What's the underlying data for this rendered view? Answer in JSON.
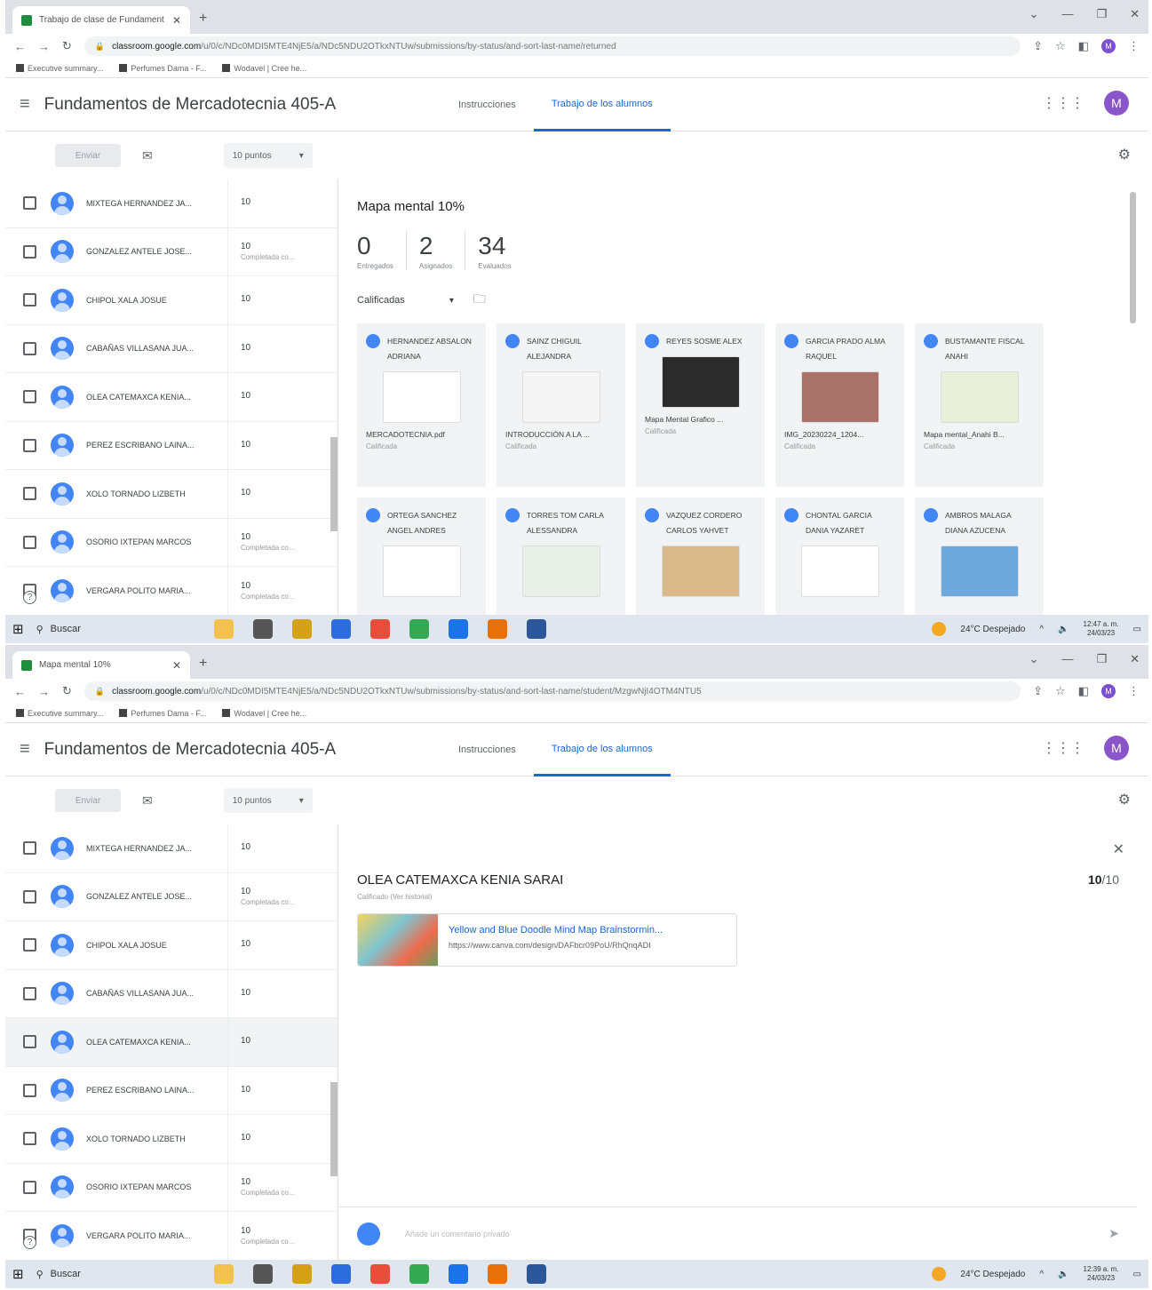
{
  "shots": [
    {
      "tab_title": "Trabajo de clase de Fundament",
      "url_domain": "classroom.google.com",
      "url_rest": "/u/0/c/NDc0MDI5MTE4NjE5/a/NDc5NDU2OTkxNTUw/submissions/by-status/and-sort-last-name/returned",
      "panel": "overview"
    },
    {
      "tab_title": "Mapa mental 10%",
      "url_domain": "classroom.google.com",
      "url_rest": "/u/0/c/NDc0MDI5MTE4NjE5/a/NDc5NDU2OTkxNTUw/submissions/by-status/and-sort-last-name/student/MzgwNjI4OTM4NTU5",
      "panel": "detail"
    }
  ],
  "browser": {
    "bookmarks": [
      "Executive summary...",
      "Perfumes Dama - F...",
      "Wodavel | Cree he..."
    ]
  },
  "classroom": {
    "course_title": "Fundamentos de Mercadotecnia 405-A",
    "nav_instructions": "Instrucciones",
    "nav_student_work": "Trabajo de los alumnos",
    "avatar_letter": "M",
    "send_label": "Enviar",
    "points_label": "10 puntos"
  },
  "students": [
    {
      "name": "MIXTEGA HERNANDEZ JA...",
      "grade": "10",
      "status": ""
    },
    {
      "name": "GONZALEZ ANTELE JOSE...",
      "grade": "10",
      "status": "Completada co..."
    },
    {
      "name": "CHIPOL XALA JOSUE",
      "grade": "10",
      "status": ""
    },
    {
      "name": "CABAÑAS VILLASANA JUA...",
      "grade": "10",
      "status": ""
    },
    {
      "name": "OLEA CATEMAXCA KENIA...",
      "grade": "10",
      "status": ""
    },
    {
      "name": "PEREZ ESCRIBANO LAINA...",
      "grade": "10",
      "status": ""
    },
    {
      "name": "XOLO TORNADO LIZBETH",
      "grade": "10",
      "status": ""
    },
    {
      "name": "OSORIO IXTEPAN MARCOS",
      "grade": "10",
      "status": "Completada co..."
    },
    {
      "name": "VERGARA POLITO MARIA...",
      "grade": "10",
      "status": "Completada co..."
    }
  ],
  "overview": {
    "assignment_title": "Mapa mental 10%",
    "stats": [
      {
        "num": "0",
        "label": "Entregados"
      },
      {
        "num": "2",
        "label": "Asignados"
      },
      {
        "num": "34",
        "label": "Evaluados"
      }
    ],
    "filter_label": "Calificadas",
    "cards": [
      {
        "name": "HERNANDEZ ABSALON ADRIANA",
        "file": "MERCADOTECNIA.pdf",
        "status": "Calificada",
        "thumb_color": "#ffffff"
      },
      {
        "name": "SAINZ CHIGUIL ALEJANDRA",
        "file": "INTRODUCCIÓN A LA ...",
        "status": "Calificada",
        "thumb_color": "#f5f5f5"
      },
      {
        "name": "REYES SOSME ALEX",
        "file": "Mapa Mental Grafico ...",
        "status": "Calificada",
        "thumb_color": "#2b2b2b"
      },
      {
        "name": "GARCIA PRADO ALMA RAQUEL",
        "file": "IMG_20230224_1204...",
        "status": "Calificada",
        "thumb_color": "#a8726a"
      },
      {
        "name": "BUSTAMANTE FISCAL ANAHI",
        "file": "Mapa mental_Anahi B...",
        "status": "Calificada",
        "thumb_color": "#e9efd9"
      },
      {
        "name": "ORTEGA SANCHEZ ANGEL ANDRES",
        "file": "",
        "status": "",
        "thumb_color": "#ffffff"
      },
      {
        "name": "TORRES TOM CARLA ALESSANDRA",
        "file": "",
        "status": "",
        "thumb_color": "#e8f0e8"
      },
      {
        "name": "VAZQUEZ CORDERO CARLOS YAHVET",
        "file": "",
        "status": "",
        "thumb_color": "#d9b88a"
      },
      {
        "name": "CHONTAL GARCIA DANIA YAZARET",
        "file": "",
        "status": "",
        "thumb_color": "#ffffff"
      },
      {
        "name": "AMBROS MALAGA DIANA AZUCENA",
        "file": "",
        "status": "",
        "thumb_color": "#6fa8dc"
      }
    ]
  },
  "detail": {
    "student_name": "OLEA CATEMAXCA KENIA SARAI",
    "score": "10",
    "score_total": "/10",
    "status": "Calificado (Ver historial)",
    "attachment_title": "Yellow and Blue Doodle Mind Map Brainstormin...",
    "attachment_url": "https://www.canva.com/design/DAFbcr09PoU/RhQnqADI",
    "comment_placeholder": "Añade un comentario privado"
  },
  "taskbar": {
    "search_label": "Buscar",
    "weather": "24°C  Despejado",
    "time_1": "12:47 a. m.",
    "time_2": "12:39 a. m.",
    "date": "24/03/23",
    "app_colors": [
      "#f2c14e",
      "#555555",
      "#d4a017",
      "#2d6cdf",
      "#e94e3c",
      "#34a853",
      "#1a73e8",
      "#e8710a",
      "#2b579a"
    ]
  }
}
